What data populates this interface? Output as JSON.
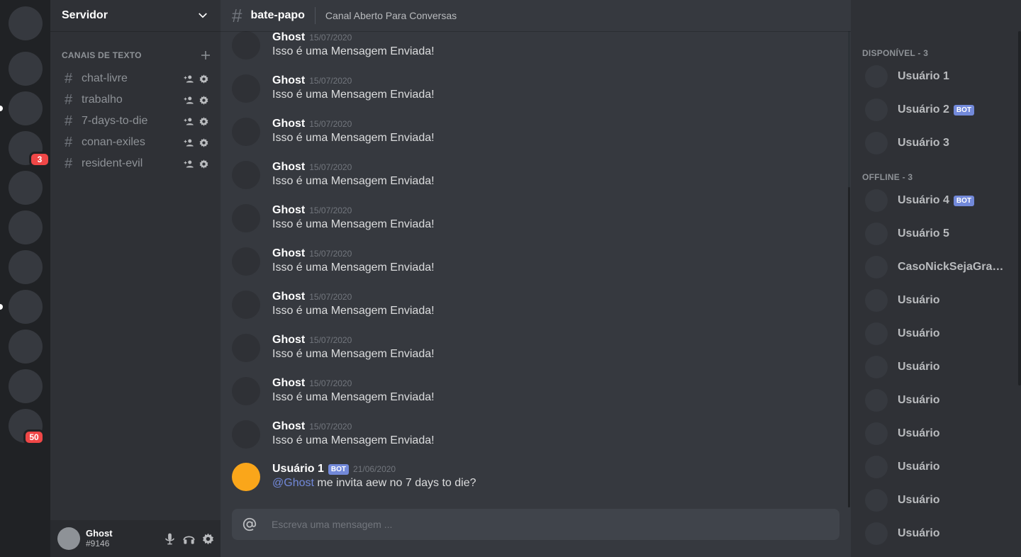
{
  "servers": {
    "badges": [
      "3",
      "50"
    ]
  },
  "sidebar": {
    "server_name": "Servidor",
    "category": "CANAIS DE TEXTO",
    "channels": [
      {
        "name": "chat-livre"
      },
      {
        "name": "trabalho"
      },
      {
        "name": "7-days-to-die"
      },
      {
        "name": "conan-exiles"
      },
      {
        "name": "resident-evil"
      }
    ]
  },
  "user_panel": {
    "name": "Ghost",
    "tag": "#9146"
  },
  "chat": {
    "channel_name": "bate-papo",
    "topic": "Canal Aberto Para Conversas",
    "messages": [
      {
        "author": "Ghost",
        "time": "15/07/2020",
        "text": "Isso é uma Mensagem Enviada!"
      },
      {
        "author": "Ghost",
        "time": "15/07/2020",
        "text": "Isso é uma Mensagem Enviada!"
      },
      {
        "author": "Ghost",
        "time": "15/07/2020",
        "text": "Isso é uma Mensagem Enviada!"
      },
      {
        "author": "Ghost",
        "time": "15/07/2020",
        "text": "Isso é uma Mensagem Enviada!"
      },
      {
        "author": "Ghost",
        "time": "15/07/2020",
        "text": "Isso é uma Mensagem Enviada!"
      },
      {
        "author": "Ghost",
        "time": "15/07/2020",
        "text": "Isso é uma Mensagem Enviada!"
      },
      {
        "author": "Ghost",
        "time": "15/07/2020",
        "text": "Isso é uma Mensagem Enviada!"
      },
      {
        "author": "Ghost",
        "time": "15/07/2020",
        "text": "Isso é uma Mensagem Enviada!"
      },
      {
        "author": "Ghost",
        "time": "15/07/2020",
        "text": "Isso é uma Mensagem Enviada!"
      },
      {
        "author": "Ghost",
        "time": "15/07/2020",
        "text": "Isso é uma Mensagem Enviada!"
      },
      {
        "author": "Usuário 1",
        "bot_tag": "BOT",
        "time": "21/06/2020",
        "mention": "@Ghost",
        "text": "me invita aew no 7 days to die?"
      }
    ],
    "composer_placeholder": "Escreva uma mensagem ..."
  },
  "members": {
    "online_header": "DISPONÍVEL - 3",
    "offline_header": "OFFLINE - 3",
    "online": [
      {
        "name": "Usuário 1"
      },
      {
        "name": "Usuário 2",
        "tag": "BOT"
      },
      {
        "name": "Usuário 3"
      }
    ],
    "offline": [
      {
        "name": "Usuário 4",
        "tag": "BOT"
      },
      {
        "name": "Usuário 5"
      },
      {
        "name": "CasoNickSejaGrandeDemais"
      },
      {
        "name": "Usuário"
      },
      {
        "name": "Usuário"
      },
      {
        "name": "Usuário"
      },
      {
        "name": "Usuário"
      },
      {
        "name": "Usuário"
      },
      {
        "name": "Usuário"
      },
      {
        "name": "Usuário"
      },
      {
        "name": "Usuário"
      }
    ]
  },
  "colors": {
    "accent": "#7289da",
    "badge": "#f04747",
    "bot_avatar": "#faa61a"
  },
  "icons": {
    "server_menu": "chevron-down-icon",
    "add_channel": "plus-icon",
    "invite": "add-user-icon",
    "settings": "gear-icon",
    "mic": "microphone-icon",
    "headset": "headphones-icon",
    "composer": "at-sign-icon"
  }
}
